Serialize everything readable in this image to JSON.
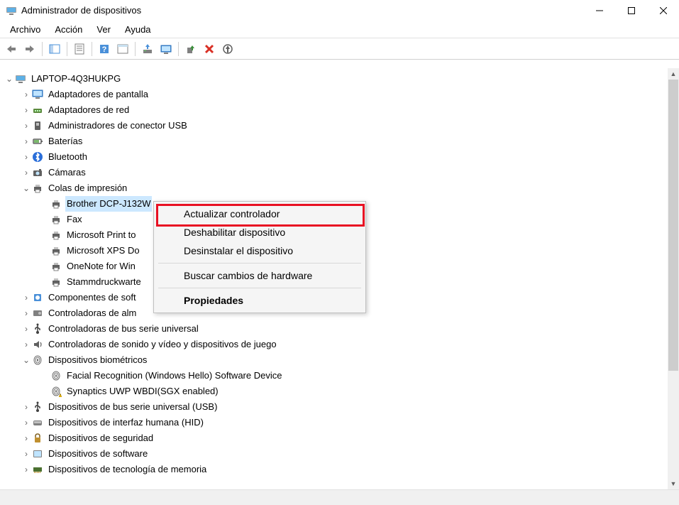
{
  "window": {
    "title": "Administrador de dispositivos"
  },
  "menubar": {
    "items": [
      "Archivo",
      "Acción",
      "Ver",
      "Ayuda"
    ]
  },
  "tree": {
    "root": "LAPTOP-4Q3HUKPG",
    "categories": [
      {
        "label": "Adaptadores de pantalla",
        "expanded": false,
        "icon": "display"
      },
      {
        "label": "Adaptadores de red",
        "expanded": false,
        "icon": "network"
      },
      {
        "label": "Administradores de conector USB",
        "expanded": false,
        "icon": "usb-conn"
      },
      {
        "label": "Baterías",
        "expanded": false,
        "icon": "battery"
      },
      {
        "label": "Bluetooth",
        "expanded": false,
        "icon": "bluetooth"
      },
      {
        "label": "Cámaras",
        "expanded": false,
        "icon": "camera"
      },
      {
        "label": "Colas de impresión",
        "expanded": true,
        "icon": "printer",
        "children": [
          {
            "label": "Brother DCP-J132W",
            "selected": true
          },
          {
            "label": "Fax"
          },
          {
            "label": "Microsoft Print to"
          },
          {
            "label": "Microsoft XPS Do"
          },
          {
            "label": "OneNote for Win"
          },
          {
            "label": "Stammdruckwarte"
          }
        ]
      },
      {
        "label": "Componentes de soft",
        "expanded": false,
        "icon": "software"
      },
      {
        "label": "Controladoras de alm",
        "expanded": false,
        "icon": "storage"
      },
      {
        "label": "Controladoras de bus serie universal",
        "expanded": false,
        "icon": "usb"
      },
      {
        "label": "Controladoras de sonido y vídeo y dispositivos de juego",
        "expanded": false,
        "icon": "sound"
      },
      {
        "label": "Dispositivos biométricos",
        "expanded": true,
        "icon": "biometric",
        "children": [
          {
            "label": "Facial Recognition (Windows Hello) Software Device",
            "icon": "biometric"
          },
          {
            "label": "Synaptics UWP WBDI(SGX enabled)",
            "icon": "biometric",
            "warn": true
          }
        ]
      },
      {
        "label": "Dispositivos de bus serie universal (USB)",
        "expanded": false,
        "icon": "usb"
      },
      {
        "label": "Dispositivos de interfaz humana (HID)",
        "expanded": false,
        "icon": "hid"
      },
      {
        "label": "Dispositivos de seguridad",
        "expanded": false,
        "icon": "security"
      },
      {
        "label": "Dispositivos de software",
        "expanded": false,
        "icon": "software2"
      },
      {
        "label": "Dispositivos de tecnología de memoria",
        "expanded": false,
        "icon": "memory",
        "cut": true
      }
    ]
  },
  "contextmenu": {
    "items": [
      {
        "label": "Actualizar controlador",
        "highlighted": true
      },
      {
        "label": "Deshabilitar dispositivo"
      },
      {
        "label": "Desinstalar el dispositivo"
      },
      {
        "sep": true
      },
      {
        "label": "Buscar cambios de hardware"
      },
      {
        "sep": true
      },
      {
        "label": "Propiedades",
        "bold": true
      }
    ]
  }
}
